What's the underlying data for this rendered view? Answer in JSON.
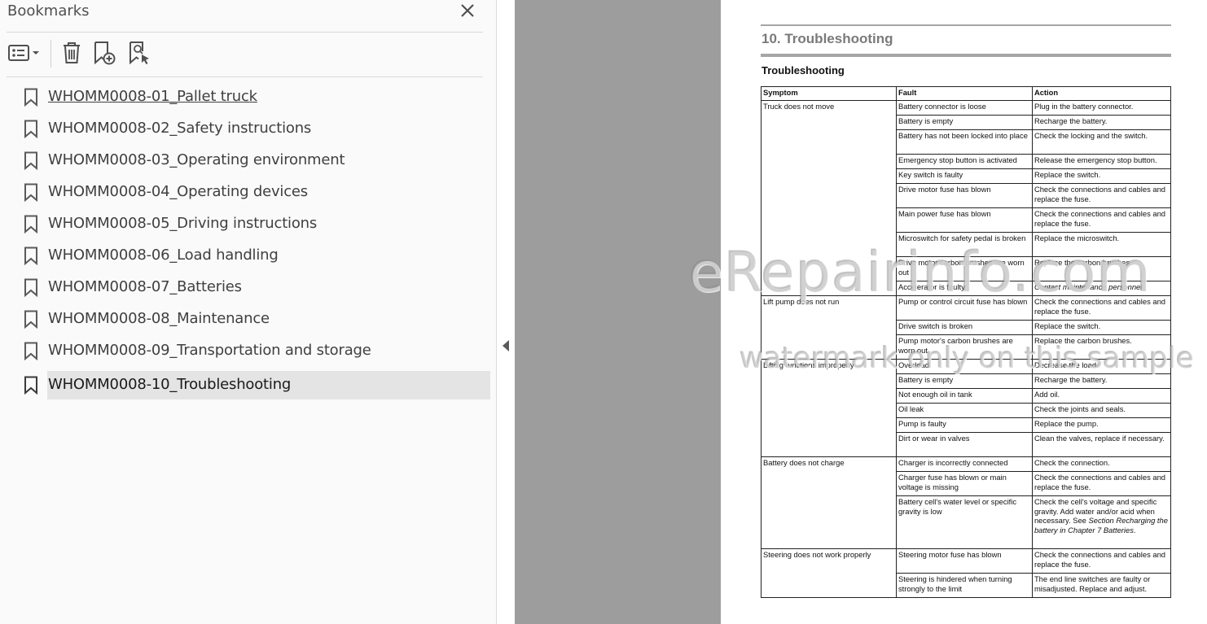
{
  "bookmarks_panel": {
    "title": "Bookmarks",
    "toolbar": {
      "options_icon": "options-list-icon",
      "delete_icon": "trash-icon",
      "new_bookmark_icon": "bookmark-add-icon",
      "find_bookmark_icon": "bookmark-find-icon"
    },
    "items": [
      {
        "label": "WHOMM0008-01_Pallet truck"
      },
      {
        "label": "WHOMM0008-02_Safety instructions"
      },
      {
        "label": "WHOMM0008-03_Operating environment"
      },
      {
        "label": "WHOMM0008-04_Operating devices"
      },
      {
        "label": "WHOMM0008-05_Driving instructions"
      },
      {
        "label": "WHOMM0008-06_Load handling"
      },
      {
        "label": "WHOMM0008-07_Batteries"
      },
      {
        "label": "WHOMM0008-08_Maintenance"
      },
      {
        "label": "WHOMM0008-09_Transportation and storage"
      },
      {
        "label": "WHOMM0008-10_Troubleshooting"
      }
    ],
    "selected_index": 9
  },
  "document": {
    "chapter_title": "10. Troubleshooting",
    "section_title": "Troubleshooting",
    "table": {
      "headers": [
        "Symptom",
        "Fault",
        "Action"
      ],
      "groups": [
        {
          "symptom": "Truck does not move",
          "rows": [
            {
              "fault": "Battery connector is loose",
              "action": "Plug in the battery connector."
            },
            {
              "fault": "Battery is empty",
              "action": "Recharge the battery."
            },
            {
              "fault": "Battery has not been locked into place",
              "action": "Check the locking and the switch."
            },
            {
              "fault": "Emergency stop button is activated",
              "action": "Release the emergency stop button."
            },
            {
              "fault": "Key switch is faulty",
              "action": "Replace the switch."
            },
            {
              "fault": "Drive motor fuse has blown",
              "action": "Check the connections and cables and replace the fuse."
            },
            {
              "fault": "Main power fuse has blown",
              "action": "Check the connections and cables and replace the fuse."
            },
            {
              "fault": "Microswitch for safety pedal is broken",
              "action": "Replace the microswitch."
            },
            {
              "fault": "Drive motor carbon brushes are worn out",
              "action": "Replace the carbon brushes."
            },
            {
              "fault": "Accelerator is faulty",
              "action": "Contact maintenance personnel."
            }
          ]
        },
        {
          "symptom": "Lift pump does not run",
          "rows": [
            {
              "fault": "Pump or control circuit fuse has blown",
              "action": "Check the connections and cables and replace the fuse."
            },
            {
              "fault": "Drive switch is broken",
              "action": "Replace the switch."
            },
            {
              "fault": "Pump motor's carbon brushes are worn out",
              "action": "Replace the carbon brushes."
            }
          ]
        },
        {
          "symptom": "Lifting functions improperly",
          "rows": [
            {
              "fault": "Overload",
              "action": "Decrease the load."
            },
            {
              "fault": "Battery is empty",
              "action": "Recharge the battery."
            },
            {
              "fault": "Not enough oil in tank",
              "action": "Add oil."
            },
            {
              "fault": "Oil leak",
              "action": "Check the joints and seals."
            },
            {
              "fault": "Pump is faulty",
              "action": "Replace the pump."
            },
            {
              "fault": "Dirt or wear in valves",
              "action": "Clean the valves, replace if necessary."
            }
          ]
        },
        {
          "symptom": "Battery does not charge",
          "rows": [
            {
              "fault": "Charger is incorrectly connected",
              "action": "Check the connection."
            },
            {
              "fault": "Charger fuse has blown or main voltage is missing",
              "action": "Check the connections and cables and replace the fuse."
            },
            {
              "fault": "Battery cell's water level or specific gravity is low",
              "action": "Check the cell's voltage and specific gravity. Add water and/or acid when necessary. See",
              "action_italic": "Section Recharging the battery in Chapter 7 Batteries",
              "action_tail": "."
            }
          ]
        },
        {
          "symptom": "Steering does not work properly",
          "rows": [
            {
              "fault": "Steering motor fuse has blown",
              "action": "Check the connections and cables and replace the fuse."
            },
            {
              "fault": "Steering is hindered when turning strongly to the limit",
              "action": "The end line switches are faulty or misadjusted. Replace and adjust."
            }
          ]
        }
      ]
    },
    "watermark_main": "eRepairinfo.com",
    "watermark_sub": "watermark only on this sample"
  }
}
